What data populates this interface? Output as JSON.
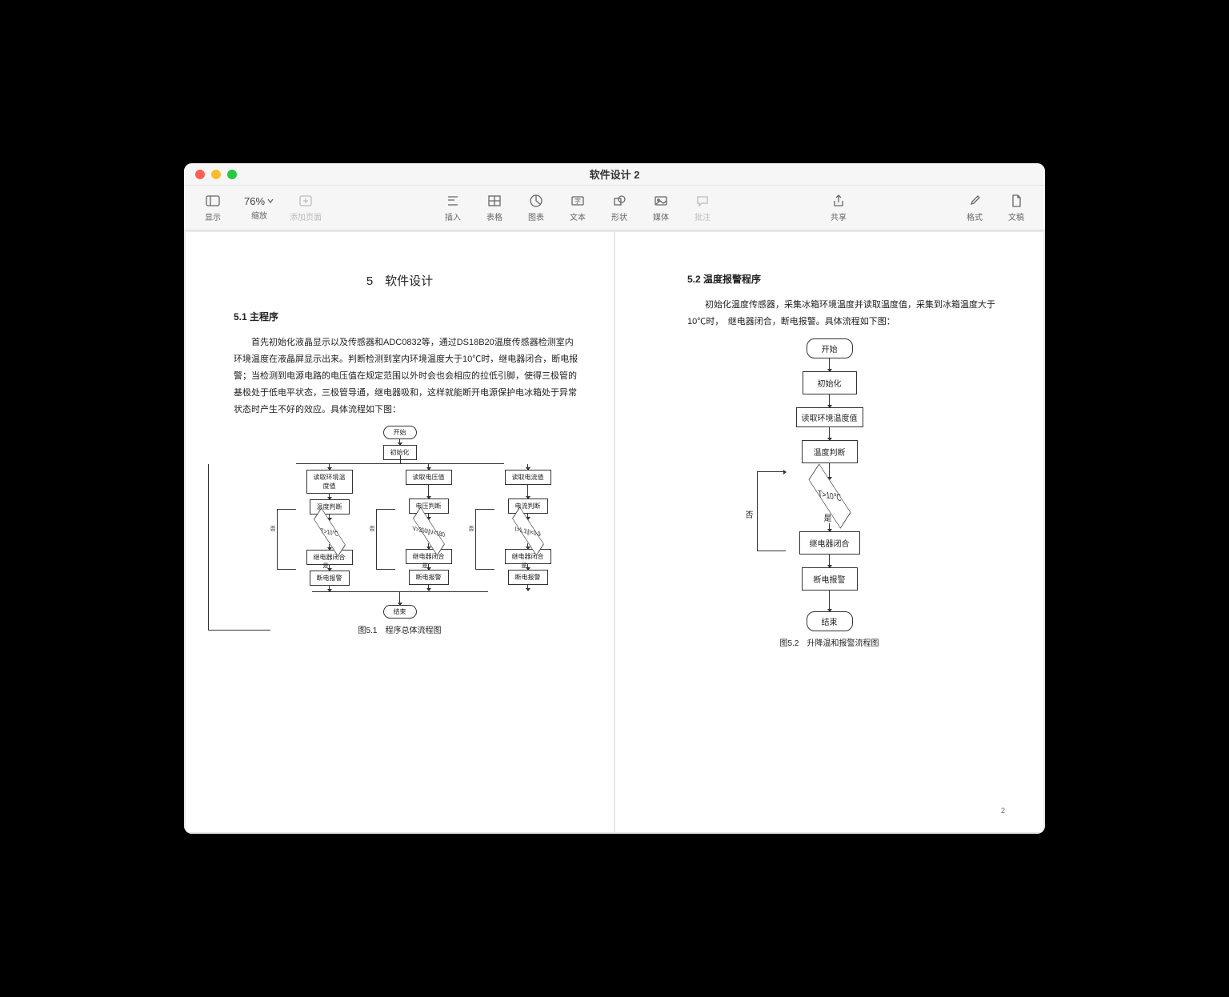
{
  "window_title": "软件设计 2",
  "toolbar": {
    "zoom": "76%",
    "view": "显示",
    "zoom_label": "缩放",
    "addpage": "添加页面",
    "insert": "插入",
    "table": "表格",
    "chart": "图表",
    "text": "文本",
    "shape": "形状",
    "media": "媒体",
    "comment": "批注",
    "share": "共享",
    "format": "格式",
    "document": "文稿"
  },
  "page1": {
    "chapter": "5　软件设计",
    "sec51": "5.1 主程序",
    "para": "首先初始化液晶显示以及传感器和ADC0832等，通过DS18B20温度传感器检测室内环境温度在液晶屏显示出来。判断检测到室内环境温度大于10℃时，继电器闭合，断电报警；当检测到电源电路的电压值在规定范围以外时会也会相应的拉低引脚，使得三极管的基极处于低电平状态，三极管导通，继电器吸和，这样就能断开电源保护电冰箱处于异常状态时产生不好的效应。具体流程如下图：",
    "fc": {
      "start": "开始",
      "init": "初始化",
      "read_temp": "读取环境温度值",
      "read_volt": "读取电压值",
      "read_cur": "读取电流值",
      "temp_judge": "温度判断",
      "volt_judge": "电压判断",
      "cur_judge": "电流判断",
      "t_cond": "T>10℃",
      "v_cond": "V>250||V<180",
      "i_cond": "I>1.1||I<0.9",
      "no": "否",
      "yes": "是",
      "relay": "继电器闭合",
      "alarm": "断电报警",
      "end": "结束"
    },
    "caption": "图5.1　程序总体流程图"
  },
  "page2": {
    "sec52": "5.2 温度报警程序",
    "para": "初始化温度传感器，采集冰箱环境温度并读取温度值，采集到冰箱温度大于10℃时，　继电器闭合，断电报警。具体流程如下图：",
    "fc": {
      "start": "开始",
      "init": "初始化",
      "read": "读取环境温度值",
      "judge": "温度判断",
      "cond": "T>10℃",
      "no": "否",
      "yes": "是",
      "relay": "继电器闭合",
      "alarm": "断电报警",
      "end": "结束"
    },
    "caption": "图5.2　升降温和报警流程图",
    "pagenum": "2"
  }
}
